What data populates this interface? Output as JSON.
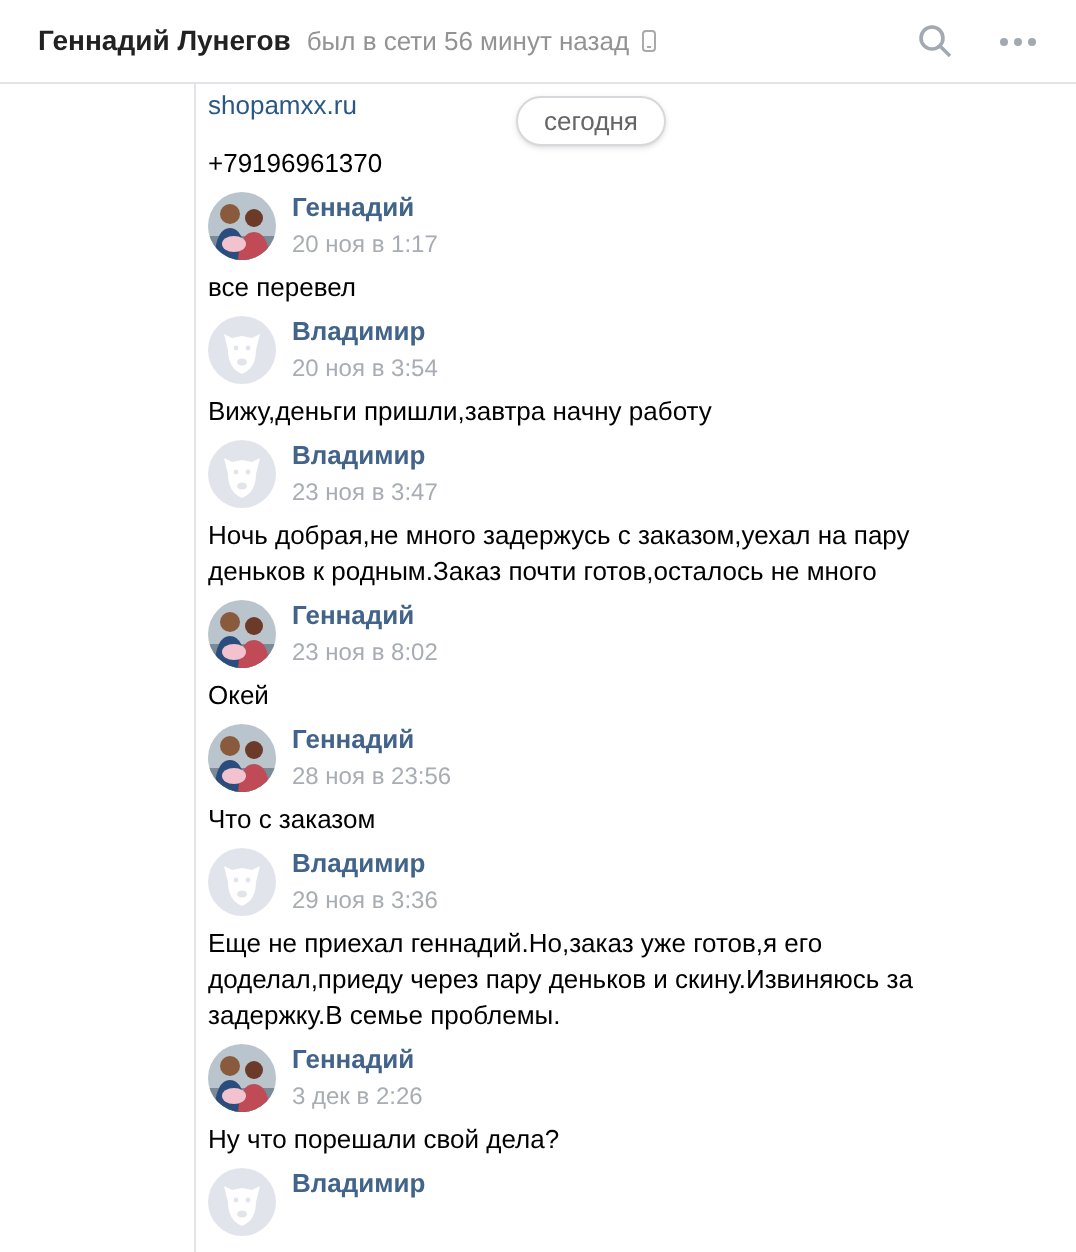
{
  "header": {
    "name": "Геннадий Лунегов",
    "status": "был в сети 56 минут назад"
  },
  "date_badge": "сегодня",
  "continued": [
    {
      "kind": "link",
      "text": "shopamxx.ru"
    },
    {
      "kind": "text",
      "text": "+79196961370"
    }
  ],
  "messages": [
    {
      "author": "Геннадий",
      "time": "20 ноя в 1:17",
      "text": "все перевел"
    },
    {
      "author": "Владимир",
      "kind": "default",
      "time": "20 ноя в 3:54",
      "text": "Вижу,деньги пришли,завтра начну работу"
    },
    {
      "author": "Владимир",
      "kind": "default",
      "time": "23 ноя в 3:47",
      "text": "Ночь добрая,не много задержусь с заказом,уехал на пару деньков к родным.Заказ почти готов,осталось не много"
    },
    {
      "author": "Геннадий",
      "time": "23 ноя в 8:02",
      "text": "Окей"
    },
    {
      "author": "Геннадий",
      "time": "28 ноя в 23:56",
      "text": "Что с заказом"
    },
    {
      "author": "Владимир",
      "kind": "default",
      "time": "29 ноя в 3:36",
      "text": "Еще не приехал геннадий.Но,заказ уже готов,я его доделал,приеду через пару деньков и скину.Извиняюсь за задержку.В семье проблемы."
    },
    {
      "author": "Геннадий",
      "time": "3 дек в 2:26",
      "text": "Ну что порешали свой дела?"
    },
    {
      "author": "Владимир",
      "kind": "default"
    }
  ]
}
